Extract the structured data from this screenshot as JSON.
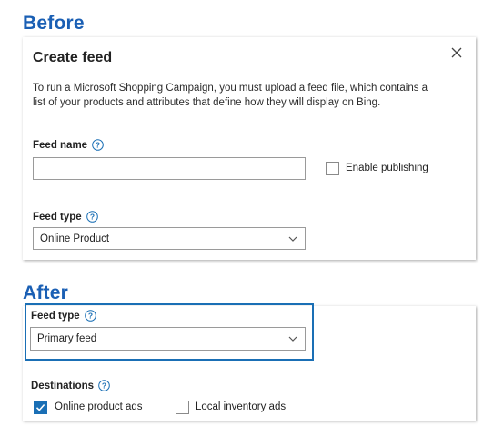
{
  "before": {
    "heading": "Before"
  },
  "after": {
    "heading": "After"
  },
  "dialog": {
    "title": "Create feed",
    "description": "To run a Microsoft Shopping Campaign, you must upload a feed file, which contains a list of your products and attributes that define how they will display on Bing.",
    "feed_name": {
      "label": "Feed name",
      "value": "",
      "placeholder": ""
    },
    "enable_publishing": {
      "label": "Enable publishing",
      "checked": false
    },
    "feed_type": {
      "label": "Feed type",
      "selected": "Online Product"
    }
  },
  "after_panel": {
    "feed_type": {
      "label": "Feed type",
      "selected": "Primary feed"
    },
    "destinations": {
      "label": "Destinations",
      "options": [
        {
          "label": "Online product ads",
          "checked": true
        },
        {
          "label": "Local inventory ads",
          "checked": false
        }
      ]
    }
  },
  "colors": {
    "accent": "#1a6fb5",
    "heading": "#1a5fb4"
  },
  "icons": {
    "close": "close-icon",
    "help": "help-icon",
    "chevron": "chevron-down-icon",
    "check": "checkmark-icon"
  }
}
